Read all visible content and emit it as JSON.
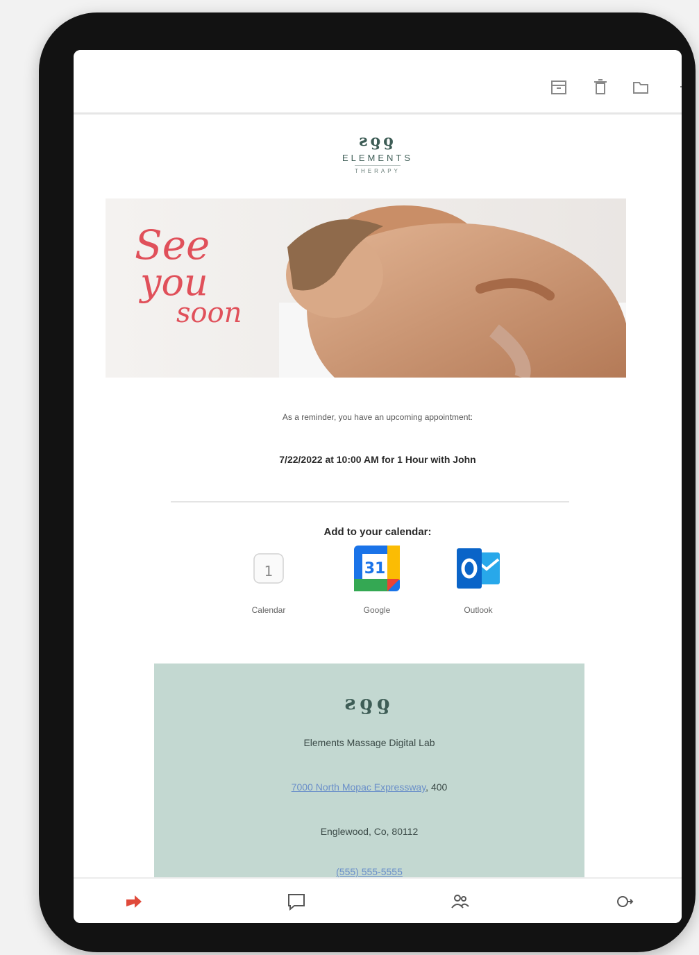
{
  "header": {
    "icons": [
      "archive-icon",
      "trash-icon",
      "folder-icon"
    ]
  },
  "brand": {
    "mark": "ƨƍƍ",
    "name": "ELEMENTS",
    "sub": "THERAPY"
  },
  "banner": {
    "script_1": "See",
    "script_2": "you",
    "script_3": "soon"
  },
  "message": {
    "reminder": "As a reminder, you have an upcoming appointment:",
    "appointment": "7/22/2022 at 10:00 AM for 1 Hour with John",
    "add_calendar": "Add to your calendar:"
  },
  "calendar_options": [
    {
      "label": "Calendar",
      "icon": "apple-calendar-icon"
    },
    {
      "label": "Google",
      "icon": "google-calendar-icon"
    },
    {
      "label": "Outlook",
      "icon": "outlook-icon"
    }
  ],
  "footer": {
    "mark": "ƨƍƍ",
    "business": "Elements Massage Digital Lab",
    "address_link": "7000 North Mopac Expressway",
    "address_suffix": ", 400",
    "city": "Englewood, Co, 80112",
    "phone_link": "(555) 555-5555"
  },
  "colors": {
    "accent": "#c3d8d1",
    "brand": "#3e5d56",
    "script": "#e0505a"
  },
  "bottom_nav": {
    "icons": [
      "reply-icon",
      "chat-icon",
      "people-icon",
      "forward-icon"
    ]
  }
}
